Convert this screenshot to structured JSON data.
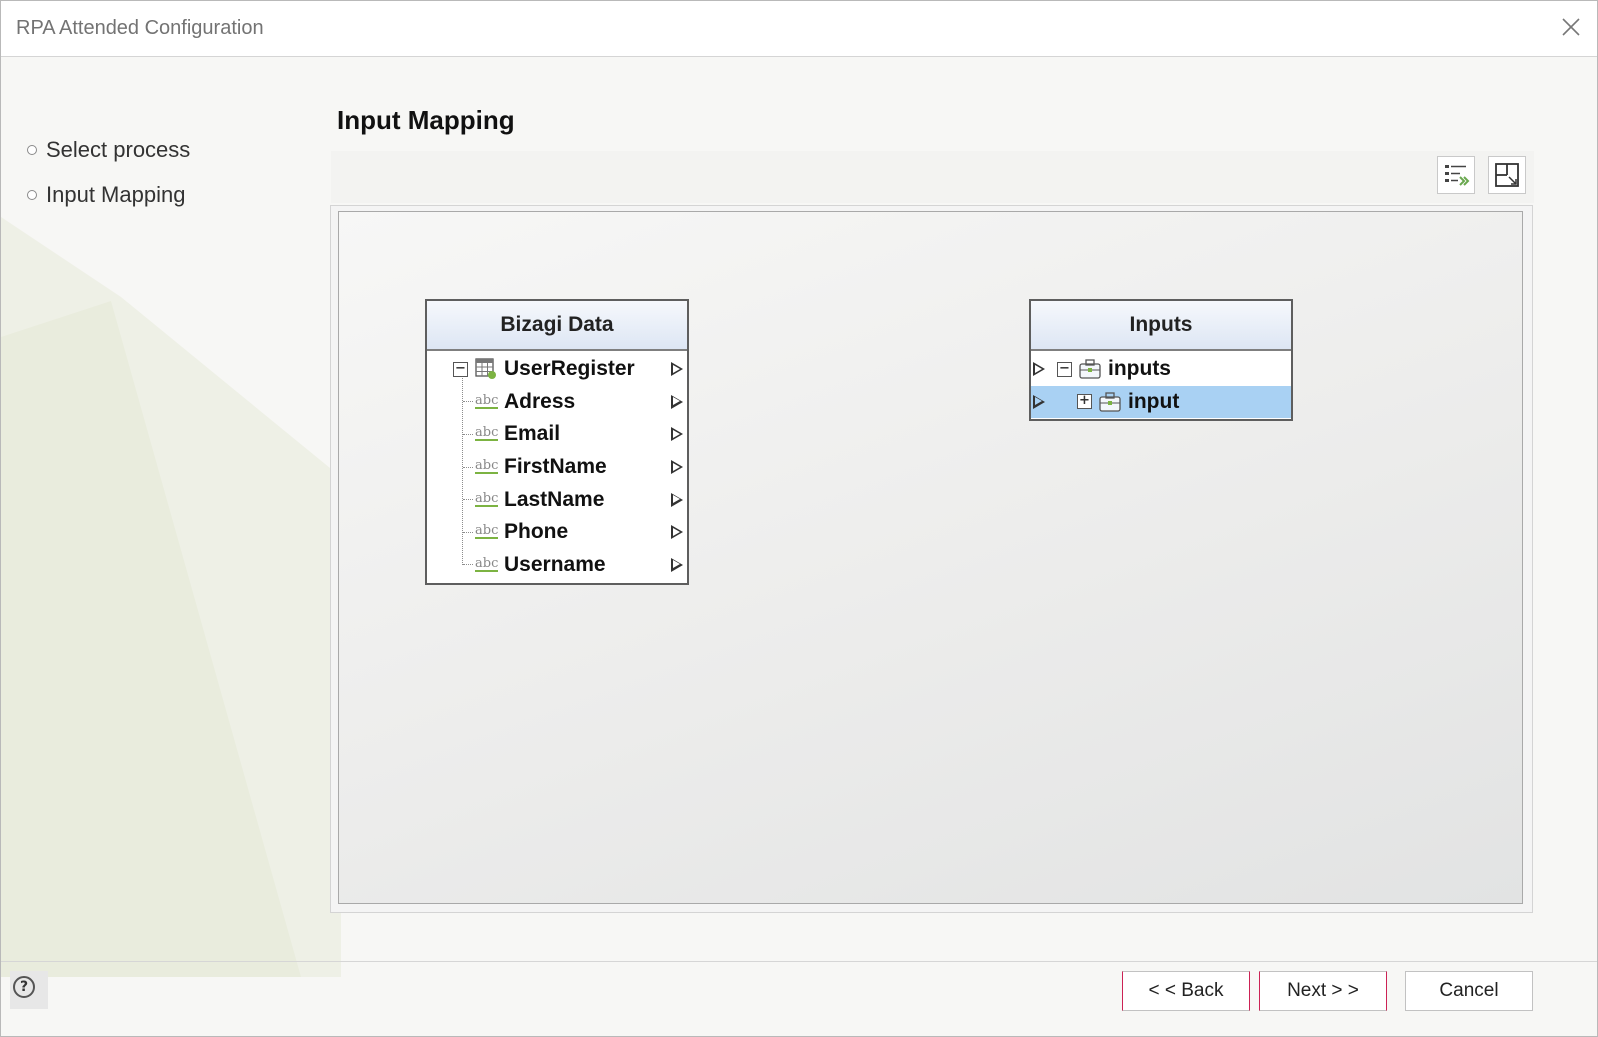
{
  "window": {
    "title": "RPA Attended Configuration"
  },
  "steps": [
    {
      "label": "Select process"
    },
    {
      "label": "Input Mapping"
    }
  ],
  "page": {
    "title": "Input Mapping"
  },
  "toolbar": {
    "buttons": [
      {
        "icon": "auto-map-icon"
      },
      {
        "icon": "fit-to-window-icon"
      }
    ]
  },
  "mapping": {
    "source": {
      "header": "Bizagi Data",
      "root": {
        "label": "UserRegister",
        "icon": "table-icon",
        "expander": "−"
      },
      "fields": [
        {
          "label": "Adress",
          "icon": "abc"
        },
        {
          "label": "Email",
          "icon": "abc"
        },
        {
          "label": "FirstName",
          "icon": "abc"
        },
        {
          "label": "LastName",
          "icon": "abc"
        },
        {
          "label": "Phone",
          "icon": "abc"
        },
        {
          "label": "Username",
          "icon": "abc"
        }
      ]
    },
    "target": {
      "header": "Inputs",
      "rows": [
        {
          "label": "inputs",
          "expander": "−",
          "icon": "object-icon",
          "selected": false
        },
        {
          "label": "input",
          "expander": "+",
          "icon": "object-icon",
          "selected": true
        }
      ]
    }
  },
  "footer": {
    "back_label": "< < Back",
    "next_label": "Next > >",
    "cancel_label": "Cancel",
    "help_label": "?"
  },
  "colors": {
    "selected_row": "#a9d1f3",
    "header_gradient_end": "#dde6f4",
    "abc_underline": "#7cb342"
  }
}
